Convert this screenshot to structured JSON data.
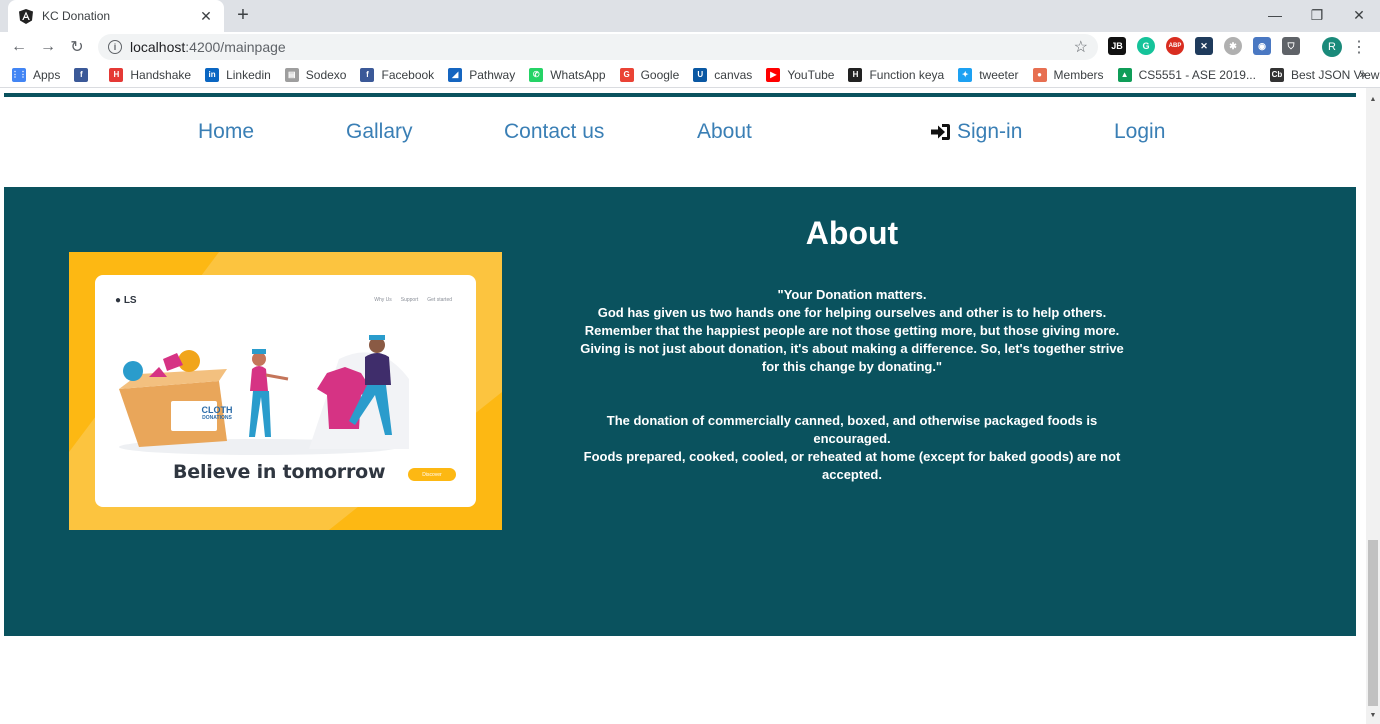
{
  "browser": {
    "tab_title": "KC Donation",
    "tab_favicon": "angular-icon",
    "url_host": "localhost",
    "url_path": ":4200/mainpage",
    "profile_initial": "R",
    "bookmarks": [
      {
        "label": "Apps",
        "icon": "apps-grid-icon",
        "color": "#4285f4"
      },
      {
        "label": "",
        "icon": "facebook-icon",
        "color": "#3b5998"
      },
      {
        "label": "Handshake",
        "icon": "handshake-icon",
        "color": "#e53935"
      },
      {
        "label": "Linkedin",
        "icon": "linkedin-icon",
        "color": "#0a66c2"
      },
      {
        "label": "Sodexo",
        "icon": "page-icon",
        "color": "#9e9e9e"
      },
      {
        "label": "Facebook",
        "icon": "facebook-icon",
        "color": "#3b5998"
      },
      {
        "label": "Pathway",
        "icon": "pathway-icon",
        "color": "#1565c0"
      },
      {
        "label": "WhatsApp",
        "icon": "whatsapp-icon",
        "color": "#25d366"
      },
      {
        "label": "Google",
        "icon": "google-icon",
        "color": "#ea4335"
      },
      {
        "label": "canvas",
        "icon": "umkc-icon",
        "color": "#0a58a3"
      },
      {
        "label": "YouTube",
        "icon": "youtube-icon",
        "color": "#ff0000"
      },
      {
        "label": "Function keya",
        "icon": "htg-icon",
        "color": "#222222"
      },
      {
        "label": "tweeter",
        "icon": "twitter-icon",
        "color": "#1da1f2"
      },
      {
        "label": "Members",
        "icon": "members-icon",
        "color": "#e76f51"
      },
      {
        "label": "CS5551 - ASE 2019...",
        "icon": "google-drive-icon",
        "color": "#0f9d58"
      },
      {
        "label": "Best JSON Viewer a...",
        "icon": "cb-icon",
        "color": "#333333"
      }
    ],
    "bookmarks_more": "»"
  },
  "nav": {
    "home": "Home",
    "gallary": "Gallary",
    "contact": "Contact us",
    "about": "About",
    "signin": "Sign-in",
    "login": "Login"
  },
  "about": {
    "title": "About",
    "quote_lines": [
      "\"Your Donation matters.",
      "God has given us two hands one for helping ourselves and other is to help others.",
      "Remember that the happiest people are not those getting more, but those giving more.",
      "Giving is not just about donation, it's about making a difference. So, let's together strive for this change by donating.\""
    ],
    "food_lines": [
      "The donation of commercially canned, boxed, and otherwise packaged foods is encouraged.",
      "Foods prepared, cooked, cooled, or reheated at home (except for baked goods) are not accepted."
    ],
    "illustration": {
      "logo": "● LS",
      "links": [
        "Why Us",
        "Support",
        "Get started"
      ],
      "box_label_1": "CLOTH",
      "box_label_2": "DONATIONS",
      "headline": "Believe in tomorrow",
      "button": "Discover"
    }
  },
  "colors": {
    "section_bg": "#0a525e",
    "nav_link": "#3a7fb5",
    "illustration_bg": "#fdb813"
  }
}
